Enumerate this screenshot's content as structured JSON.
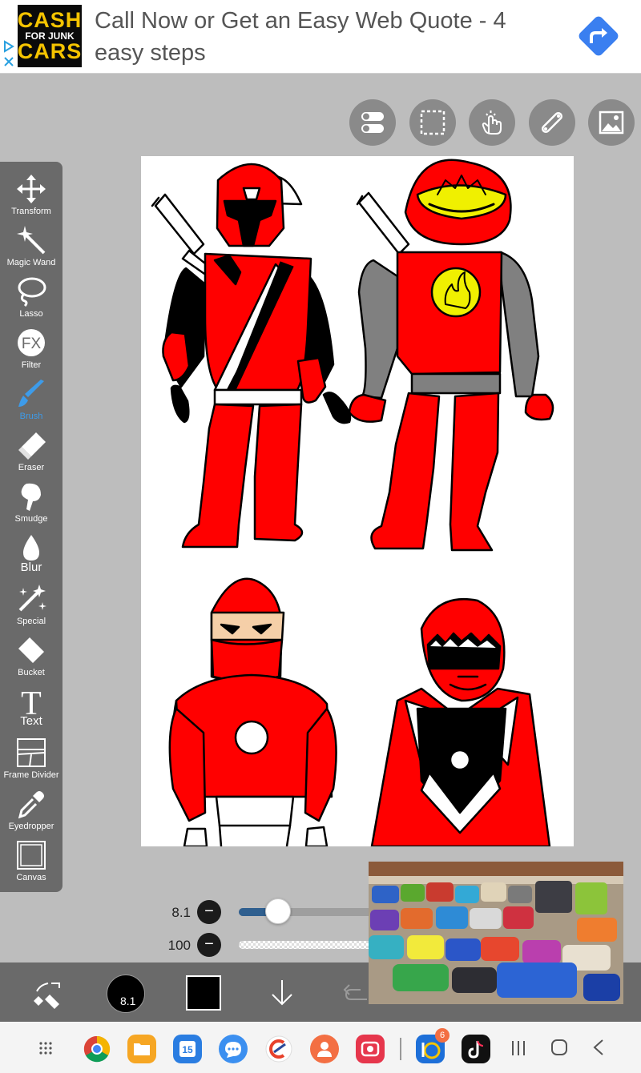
{
  "ad": {
    "logo_line1": "CASH",
    "logo_line2": "FOR JUNK",
    "logo_line3": "CARS",
    "headline": "Call Now or Get an Easy Web Quote - 4 easy steps"
  },
  "top_tools": [
    {
      "icon": "toggle-icon"
    },
    {
      "icon": "selection-icon"
    },
    {
      "icon": "touch-icon"
    },
    {
      "icon": "ruler-icon"
    },
    {
      "icon": "image-icon"
    }
  ],
  "tools": [
    {
      "label": "Transform",
      "icon": "transform-icon"
    },
    {
      "label": "Magic Wand",
      "icon": "magic-wand-icon"
    },
    {
      "label": "Lasso",
      "icon": "lasso-icon"
    },
    {
      "label": "Filter",
      "icon": "fx-icon"
    },
    {
      "label": "Brush",
      "icon": "brush-icon",
      "active": true
    },
    {
      "label": "Eraser",
      "icon": "eraser-icon"
    },
    {
      "label": "Smudge",
      "icon": "smudge-icon"
    },
    {
      "label": "Blur",
      "icon": "blur-icon"
    },
    {
      "label": "Special",
      "icon": "special-icon"
    },
    {
      "label": "Bucket",
      "icon": "bucket-icon"
    },
    {
      "label": "Text",
      "icon": "text-icon"
    },
    {
      "label": "Frame Divider",
      "icon": "frame-divider-icon"
    },
    {
      "label": "Eyedropper",
      "icon": "eyedropper-icon"
    },
    {
      "label": "Canvas",
      "icon": "canvas-icon"
    }
  ],
  "fx_text": "FX",
  "text_tool_glyph": "T",
  "brush": {
    "size_label": "8.1",
    "size_fraction": 0.29,
    "opacity_label": "100",
    "preview_size": "8.1",
    "color": "#000000"
  },
  "nav": {
    "calendar_day": "15",
    "badge_count": "6"
  },
  "colors": {
    "accent": "#3d9be9",
    "toolbar": "#6a6a6a",
    "suit_red": "#ff0000",
    "visor_yellow": "#f0f000"
  }
}
